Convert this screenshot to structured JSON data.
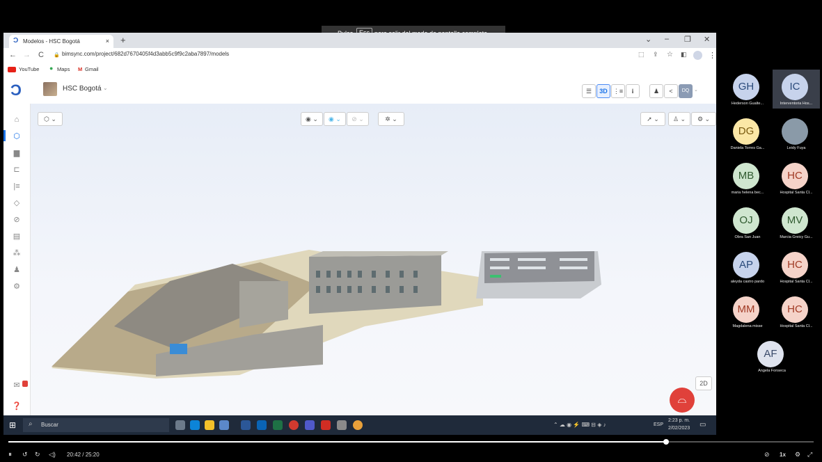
{
  "fullscreen_msg": {
    "before": "Pulsa",
    "key": "Esc",
    "after": "para salir del modo de pantalla completa"
  },
  "browser": {
    "tab_title": "Modelos - HSC Bogotá",
    "tab_close": "×",
    "new_tab": "+",
    "url": "bimsync.com/project/682d7670405f4d3abb5c9f9c2aba7897/models",
    "bookmarks": [
      "YouTube",
      "Maps",
      "Gmail"
    ],
    "win_controls": [
      "⌄",
      "–",
      "❐",
      "✕"
    ]
  },
  "app": {
    "project": "HSC Bogotá",
    "view_3d": "3D",
    "view_2d": "2D",
    "user_initials": "DQ",
    "info": "i"
  },
  "taskbar": {
    "search": "Buscar",
    "lang": "ESP",
    "time": "2:23 p. m.",
    "date": "2/02/2023"
  },
  "participants": [
    {
      "initials": "GH",
      "name": "Hederson Gualte...",
      "bg": "#c7d3ec",
      "fg": "#2a4a7a"
    },
    {
      "initials": "IC",
      "name": "Interventoria Hos...",
      "bg": "#c7d3ec",
      "fg": "#2a4a7a"
    },
    {
      "initials": "DG",
      "name": "Daniela Torres Ga...",
      "bg": "#fbe7a6",
      "fg": "#7a5a10"
    },
    {
      "initials": "",
      "name": "Leidy Fuya",
      "bg": "#8a9aa8",
      "fg": "#fff",
      "photo": true
    },
    {
      "initials": "MB",
      "name": "maria helena bec...",
      "bg": "#cfe6cf",
      "fg": "#2f5a2f"
    },
    {
      "initials": "HC",
      "name": "Hospital Santa Cl...",
      "bg": "#f5d3c9",
      "fg": "#a03a24"
    },
    {
      "initials": "OJ",
      "name": "Obra San Juan",
      "bg": "#cfe6cf",
      "fg": "#2f5a2f"
    },
    {
      "initials": "MV",
      "name": "Marcia Greicy Gu...",
      "bg": "#cfe6cf",
      "fg": "#2f5a2f"
    },
    {
      "initials": "AP",
      "name": "aleyda castro pardo",
      "bg": "#c7d3ec",
      "fg": "#2a4a7a"
    },
    {
      "initials": "HC",
      "name": "Hospital Santa Cl...",
      "bg": "#f5d3c9",
      "fg": "#a03a24"
    },
    {
      "initials": "MM",
      "name": "Magdalena misse",
      "bg": "#f5d3c9",
      "fg": "#a03a24"
    },
    {
      "initials": "HC",
      "name": "Hospital Santa Cl...",
      "bg": "#f5d3c9",
      "fg": "#a03a24"
    },
    {
      "initials": "AF",
      "name": "Angela Fonseca",
      "bg": "#dfe3ee",
      "fg": "#3a4a6a"
    }
  ],
  "player": {
    "time": "20:42 / 25:20",
    "speed": "1x",
    "progress": 0.8165
  },
  "colors": {
    "accent": "#1a73e8",
    "chat": "#e0413a",
    "brand": "#2a5fbf"
  }
}
